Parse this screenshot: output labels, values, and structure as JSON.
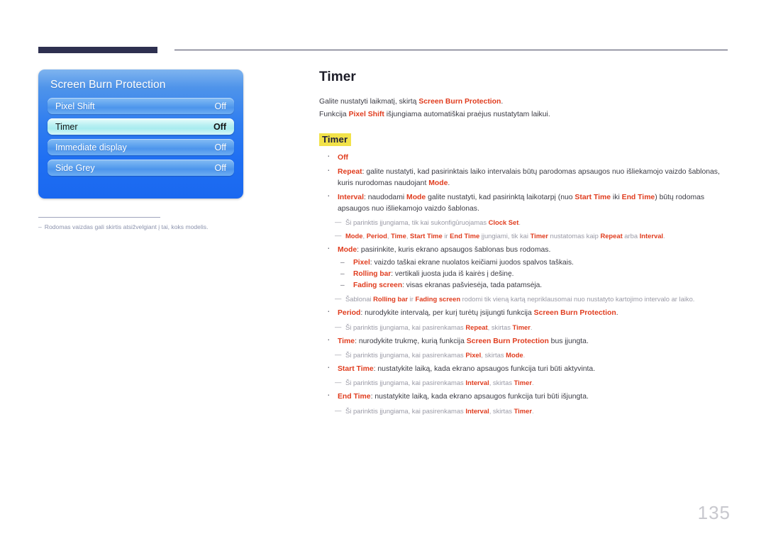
{
  "page": {
    "number": "135",
    "title": "Timer"
  },
  "osd": {
    "title": "Screen Burn Protection",
    "rows": [
      {
        "label": "Pixel Shift",
        "value": "Off",
        "selected": false
      },
      {
        "label": "Timer",
        "value": "Off",
        "selected": true
      },
      {
        "label": "Immediate display",
        "value": "Off",
        "selected": false
      },
      {
        "label": "Side Grey",
        "value": "Off",
        "selected": false
      }
    ],
    "footnote": {
      "dash": "–",
      "text": "Rodomas vaizdas gali skirtis atsižvelgiant į tai, koks modelis."
    }
  },
  "content": {
    "intro_line_1": {
      "pre": "Galite nustatyti laikmatį, skirtą ",
      "accent": "Screen Burn Protection",
      "post": "."
    },
    "intro_line_2": {
      "pre": "Funkcija ",
      "accent": "Pixel Shift",
      "post": " išjungiama automatiškai praėjus nustatytam laikui."
    },
    "sub_head": "Timer",
    "items": {
      "off": "Off",
      "repeat_label": "Repeat",
      "repeat_text": ": galite nustatyti, kad pasirinktais laiko intervalais būtų parodomas apsaugos nuo išliekamojo vaizdo šablonas, kuris nurodomas naudojant ",
      "repeat_mode": "Mode",
      "repeat_end": ".",
      "interval_label": "Interval",
      "interval_t1": ": naudodami ",
      "interval_mode": "Mode",
      "interval_t2": " galite nustatyti, kad pasirinktą laikotarpį (nuo ",
      "interval_start": "Start Time",
      "interval_t3": " iki ",
      "interval_end": "End Time",
      "interval_t4": ") būtų rodomas apsaugos nuo išliekamojo vaizdo šablonas.",
      "note_clock_pre": "Ši parinktis įjungiama, tik kai sukonfigūruojamas ",
      "note_clock_accent": "Clock Set",
      "note_clock_post": ".",
      "note_modes_a": "Mode",
      "note_modes_sep1": ", ",
      "note_modes_b": "Period",
      "note_modes_sep2": ", ",
      "note_modes_c": "Time",
      "note_modes_sep3": ", ",
      "note_modes_d": "Start Time",
      "note_modes_ir": " ir ",
      "note_modes_e": "End Time",
      "note_modes_mid": " įjungiami, tik kai ",
      "note_modes_timer": "Timer",
      "note_modes_mid2": " nustatomas kaip ",
      "note_modes_repeat": "Repeat",
      "note_modes_arba": " arba ",
      "note_modes_interval": "Interval",
      "note_modes_end": ".",
      "mode_label": "Mode",
      "mode_text": ": pasirinkite, kuris ekrano apsaugos šablonas bus rodomas.",
      "mode_sub": [
        {
          "label": "Pixel",
          "text": ": vaizdo taškai ekrane nuolatos keičiami juodos spalvos taškais."
        },
        {
          "label": "Rolling bar",
          "text": ": vertikali juosta juda iš kairės į dešinę."
        },
        {
          "label": "Fading screen",
          "text": ": visas ekranas pašviesėja, tada patamsėja."
        }
      ],
      "note_patterns_pre": "Šablonai ",
      "note_patterns_a": "Rolling bar",
      "note_patterns_ir": " ir ",
      "note_patterns_b": "Fading screen",
      "note_patterns_post": " rodomi tik vieną kartą nepriklausomai nuo nustatyto kartojimo intervalo ar laiko.",
      "period_label": "Period",
      "period_t1": ": nurodykite intervalą, per kurį turėtų įsijungti funkcija ",
      "period_accent": "Screen Burn Protection",
      "period_t2": ".",
      "note_period_pre": "Ši parinktis įjungiama, kai pasirenkamas ",
      "note_period_a": "Repeat",
      "note_period_mid": ", skirtas ",
      "note_period_b": "Timer",
      "note_period_post": ".",
      "time_label": "Time",
      "time_t1": ": nurodykite trukmę, kurią funkcija ",
      "time_accent": "Screen Burn Protection",
      "time_t2": " bus įjungta.",
      "note_time_pre": "Ši parinktis įjungiama, kai pasirenkamas ",
      "note_time_a": "Pixel",
      "note_time_mid": ", skirtas ",
      "note_time_b": "Mode",
      "note_time_post": ".",
      "start_label": "Start Time",
      "start_text": ": nustatykite laiką, kada ekrano apsaugos funkcija turi būti aktyvinta.",
      "note_start_pre": "Ši parinktis įjungiama, kai pasirenkamas ",
      "note_start_a": "Interval",
      "note_start_mid": ", skirtas ",
      "note_start_b": "Timer",
      "note_start_post": ".",
      "end_label": "End Time",
      "end_text": ": nustatykite laiką, kada ekrano apsaugos funkcija turi būti išjungta.",
      "note_end_pre": "Ši parinktis įjungiama, kai pasirenkamas ",
      "note_end_a": "Interval",
      "note_end_mid": ", skirtas ",
      "note_end_b": "Timer",
      "note_end_post": "."
    }
  },
  "colors": {
    "accent_red": "#e03c1e",
    "highlight_yellow": "#f2e24a",
    "header_navy": "#2e3050",
    "osd_blue": "#1f6ff2"
  }
}
